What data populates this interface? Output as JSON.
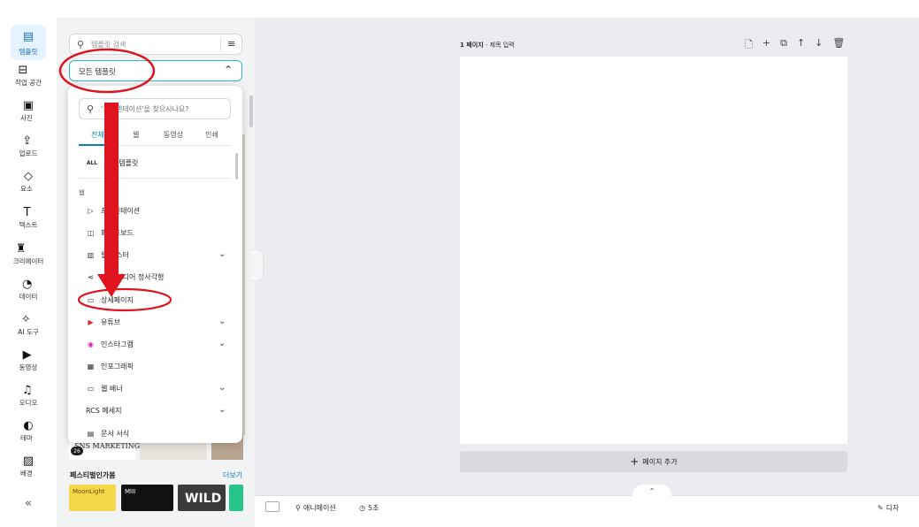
{
  "rail": {
    "items": [
      {
        "label": "템플릿",
        "icon": "template-icon",
        "glyph": "▤"
      },
      {
        "label": "작업 공간",
        "icon": "folder-icon",
        "glyph": "⊟"
      },
      {
        "label": "사진",
        "icon": "photo-icon",
        "glyph": "▣"
      },
      {
        "label": "업로드",
        "icon": "upload-icon",
        "glyph": "⇪"
      },
      {
        "label": "요소",
        "icon": "elements-icon",
        "glyph": "◇"
      },
      {
        "label": "텍스트",
        "icon": "text-icon",
        "glyph": "T"
      },
      {
        "label": "크리에이터",
        "icon": "creator-icon",
        "glyph": "♜"
      },
      {
        "label": "데이터",
        "icon": "data-icon",
        "glyph": "◔"
      },
      {
        "label": "AI 도구",
        "icon": "ai-tools-icon",
        "glyph": "✧"
      },
      {
        "label": "동영상",
        "icon": "video-icon",
        "glyph": "▶"
      },
      {
        "label": "오디오",
        "icon": "audio-icon",
        "glyph": "♫"
      },
      {
        "label": "테마",
        "icon": "theme-icon",
        "glyph": "◐"
      },
      {
        "label": "배경",
        "icon": "background-icon",
        "glyph": "▨"
      }
    ],
    "collapse": "«"
  },
  "panel": {
    "search_placeholder": "템플릿 검색",
    "select_value": "모든 템플릿",
    "dropdown": {
      "search_placeholder": "'프레젠테이션'을 찾으시나요?",
      "tabs": [
        "전체",
        "웹",
        "동영상",
        "인쇄"
      ],
      "all_badge": "ALL",
      "all_label": "모든 템플릿",
      "group_label": "웹",
      "items": [
        {
          "label": "프레젠테이션",
          "icon": "presentation-icon",
          "glyph": "▷",
          "expand": false
        },
        {
          "label": "화이트보드",
          "icon": "whiteboard-icon",
          "glyph": "◫",
          "expand": false
        },
        {
          "label": "웹 포스터",
          "icon": "poster-icon",
          "glyph": "▥",
          "expand": true
        },
        {
          "label": "소셜 미디어 정사각형",
          "icon": "share-icon",
          "glyph": "⋖",
          "expand": false
        },
        {
          "label": "상세페이지",
          "icon": "detail-page-icon",
          "glyph": "▭",
          "expand": false
        },
        {
          "label": "유튜브",
          "icon": "youtube-icon",
          "glyph": "▶",
          "expand": true
        },
        {
          "label": "인스타그램",
          "icon": "instagram-icon",
          "glyph": "◉",
          "expand": true
        },
        {
          "label": "인포그래픽",
          "icon": "infographic-icon",
          "glyph": "▦",
          "expand": false
        },
        {
          "label": "웹 배너",
          "icon": "web-banner-icon",
          "glyph": "▭",
          "expand": true
        },
        {
          "label": "RCS 메세지",
          "icon": "",
          "glyph": "",
          "expand": true
        },
        {
          "label": "문서 서식",
          "icon": "document-icon",
          "glyph": "▤",
          "expand": false
        }
      ]
    },
    "card_text": "SNS MARKETING",
    "card_badge": "26",
    "section_title": "페스티벌인가봄",
    "more_link": "더보기",
    "tiles": [
      {
        "text": "MoonLight",
        "color": "#f5d74a"
      },
      {
        "text": "MIII",
        "color": "#111111"
      },
      {
        "text": "WILD",
        "color": "#3b3b3b"
      },
      {
        "text": "",
        "color": "#27c48a"
      }
    ]
  },
  "canvas": {
    "page_number": "1 페이지",
    "title_placeholder": "- 제목 입력",
    "add_page": "페이지 추가",
    "tools": [
      "page-icon",
      "add-icon",
      "duplicate-icon",
      "move-up-icon",
      "move-down-icon",
      "delete-icon"
    ],
    "tool_glyphs": [
      "🗋",
      "+",
      "⧉",
      "↑",
      "↓",
      "🗑"
    ]
  },
  "bottom": {
    "animation": "애니메이션",
    "duration": "5초",
    "right_label": "디자"
  },
  "colors": {
    "accent": "#1a6fb8",
    "link": "#0c7fb0",
    "annotation": "#e0141e",
    "select_border": "#37b6c2"
  }
}
